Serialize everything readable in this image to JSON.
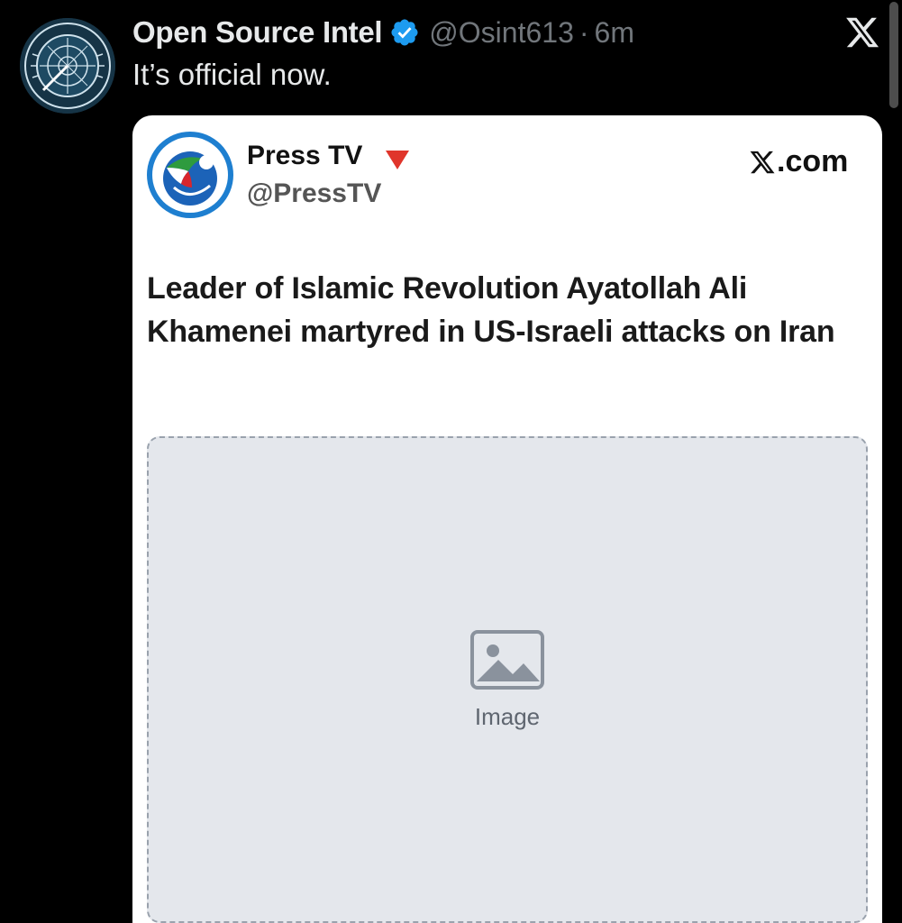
{
  "tweet": {
    "author_name": "Open Source Intel",
    "author_handle": "@Osint613",
    "separator": "·",
    "time": "6m",
    "text": "It’s official now.",
    "avatar_icon": "osint-logo-icon",
    "verified_icon": "verified-badge-icon"
  },
  "embed": {
    "source_name": "Press TV",
    "source_handle": "@PressTV",
    "source_domain": ".com",
    "headline": "Leader of Islamic Revolution Ayatollah Ali Khamenei martyred in US-Israeli attacks on Iran",
    "image_label": "Image"
  },
  "colors": {
    "background": "#000000",
    "primary_text": "#e7e9ea",
    "secondary_text": "#71767b",
    "verified_blue": "#1d9bf0",
    "card_background": "#ffffff",
    "presstv_badge_red": "#e0352b"
  }
}
